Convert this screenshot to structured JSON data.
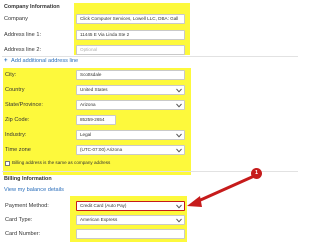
{
  "company_section": {
    "title": "Company Information",
    "fields": {
      "company": {
        "label": "Company",
        "value": "Click Computer Services, Lowell LLC, DBA: Gall"
      },
      "address1": {
        "label": "Address line 1:",
        "value": "11445 E Via Linda Ste 2"
      },
      "address2": {
        "label": "Address line 2:",
        "placeholder": "Optional"
      },
      "add_line_link": "Add additional address line",
      "add_line_icon": "plus-icon",
      "city": {
        "label": "City:",
        "value": "Scottsdale"
      },
      "country": {
        "label": "Country",
        "value": "United States"
      },
      "state": {
        "label": "State/Province:",
        "value": "Arizona"
      },
      "zip": {
        "label": "Zip Code:",
        "value": "85259-2654"
      },
      "industry": {
        "label": "Industry:",
        "value": "Legal"
      },
      "timezone": {
        "label": "Time zone",
        "value": "(UTC-07:00) Arizona"
      }
    },
    "billing_same": {
      "label": "Billing address is the same as company address",
      "checked": false
    }
  },
  "billing_section": {
    "title": "Billing Information",
    "balance_link": "View my balance details",
    "fields": {
      "payment_method": {
        "label": "Payment Method:",
        "value": "Credit Card (Auto Pay)"
      },
      "card_type": {
        "label": "Card Type:",
        "value": "American Express"
      },
      "card_number": {
        "label": "Card Number:",
        "value": ""
      }
    }
  },
  "annotation": {
    "badge": "1",
    "color": "#c61b1b"
  },
  "colors": {
    "highlight": "#fdf93c",
    "link": "#2a6ebb"
  }
}
